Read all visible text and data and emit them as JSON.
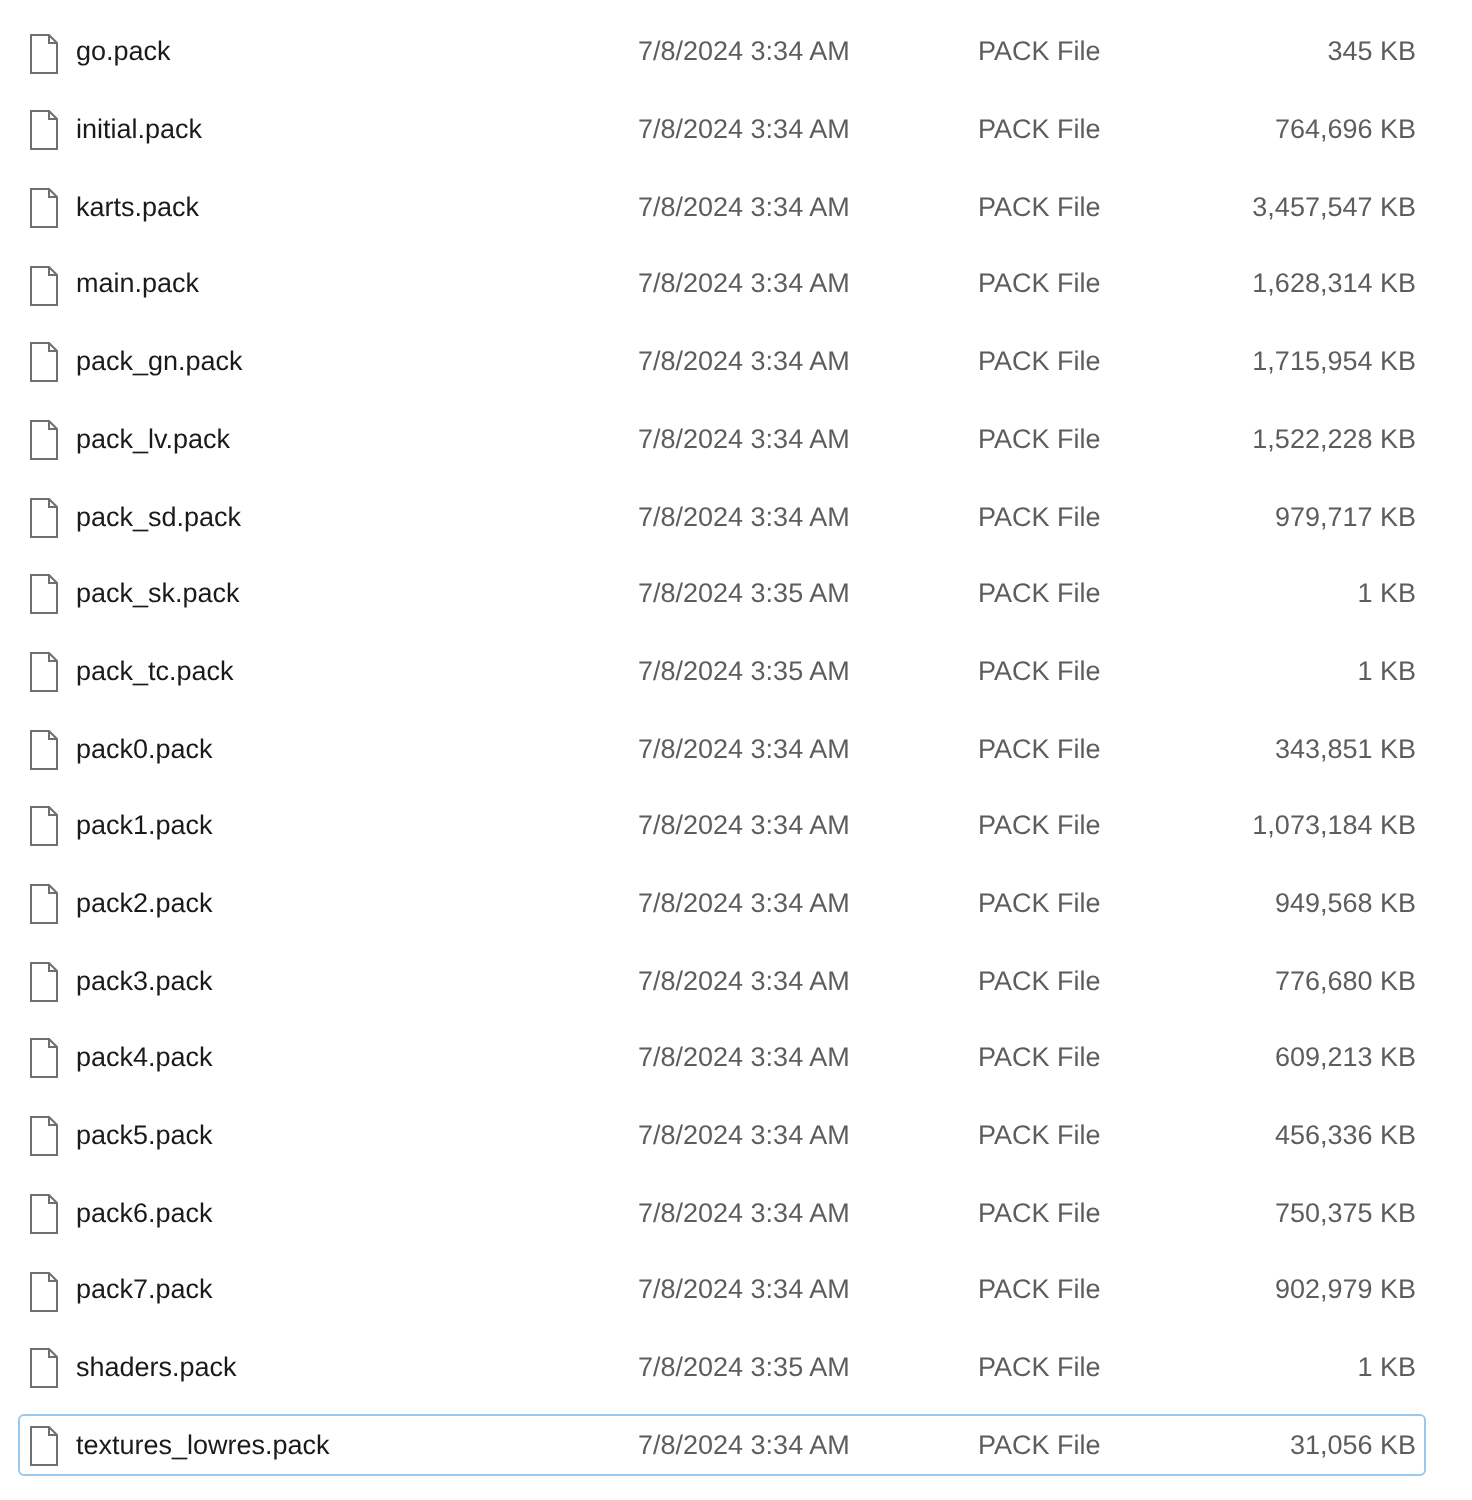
{
  "files": [
    {
      "name": "go.pack",
      "date": "7/8/2024 3:34 AM",
      "type": "PACK File",
      "size": "345 KB",
      "focused": false
    },
    {
      "name": "initial.pack",
      "date": "7/8/2024 3:34 AM",
      "type": "PACK File",
      "size": "764,696 KB",
      "focused": false
    },
    {
      "name": "karts.pack",
      "date": "7/8/2024 3:34 AM",
      "type": "PACK File",
      "size": "3,457,547 KB",
      "focused": false
    },
    {
      "name": "main.pack",
      "date": "7/8/2024 3:34 AM",
      "type": "PACK File",
      "size": "1,628,314 KB",
      "focused": false
    },
    {
      "name": "pack_gn.pack",
      "date": "7/8/2024 3:34 AM",
      "type": "PACK File",
      "size": "1,715,954 KB",
      "focused": false
    },
    {
      "name": "pack_lv.pack",
      "date": "7/8/2024 3:34 AM",
      "type": "PACK File",
      "size": "1,522,228 KB",
      "focused": false
    },
    {
      "name": "pack_sd.pack",
      "date": "7/8/2024 3:34 AM",
      "type": "PACK File",
      "size": "979,717 KB",
      "focused": false
    },
    {
      "name": "pack_sk.pack",
      "date": "7/8/2024 3:35 AM",
      "type": "PACK File",
      "size": "1 KB",
      "focused": false
    },
    {
      "name": "pack_tc.pack",
      "date": "7/8/2024 3:35 AM",
      "type": "PACK File",
      "size": "1 KB",
      "focused": false
    },
    {
      "name": "pack0.pack",
      "date": "7/8/2024 3:34 AM",
      "type": "PACK File",
      "size": "343,851 KB",
      "focused": false
    },
    {
      "name": "pack1.pack",
      "date": "7/8/2024 3:34 AM",
      "type": "PACK File",
      "size": "1,073,184 KB",
      "focused": false
    },
    {
      "name": "pack2.pack",
      "date": "7/8/2024 3:34 AM",
      "type": "PACK File",
      "size": "949,568 KB",
      "focused": false
    },
    {
      "name": "pack3.pack",
      "date": "7/8/2024 3:34 AM",
      "type": "PACK File",
      "size": "776,680 KB",
      "focused": false
    },
    {
      "name": "pack4.pack",
      "date": "7/8/2024 3:34 AM",
      "type": "PACK File",
      "size": "609,213 KB",
      "focused": false
    },
    {
      "name": "pack5.pack",
      "date": "7/8/2024 3:34 AM",
      "type": "PACK File",
      "size": "456,336 KB",
      "focused": false
    },
    {
      "name": "pack6.pack",
      "date": "7/8/2024 3:34 AM",
      "type": "PACK File",
      "size": "750,375 KB",
      "focused": false
    },
    {
      "name": "pack7.pack",
      "date": "7/8/2024 3:34 AM",
      "type": "PACK File",
      "size": "902,979 KB",
      "focused": false
    },
    {
      "name": "shaders.pack",
      "date": "7/8/2024 3:35 AM",
      "type": "PACK File",
      "size": "1 KB",
      "focused": false
    },
    {
      "name": "textures_lowres.pack",
      "date": "7/8/2024 3:34 AM",
      "type": "PACK File",
      "size": "31,056 KB",
      "focused": true
    }
  ]
}
